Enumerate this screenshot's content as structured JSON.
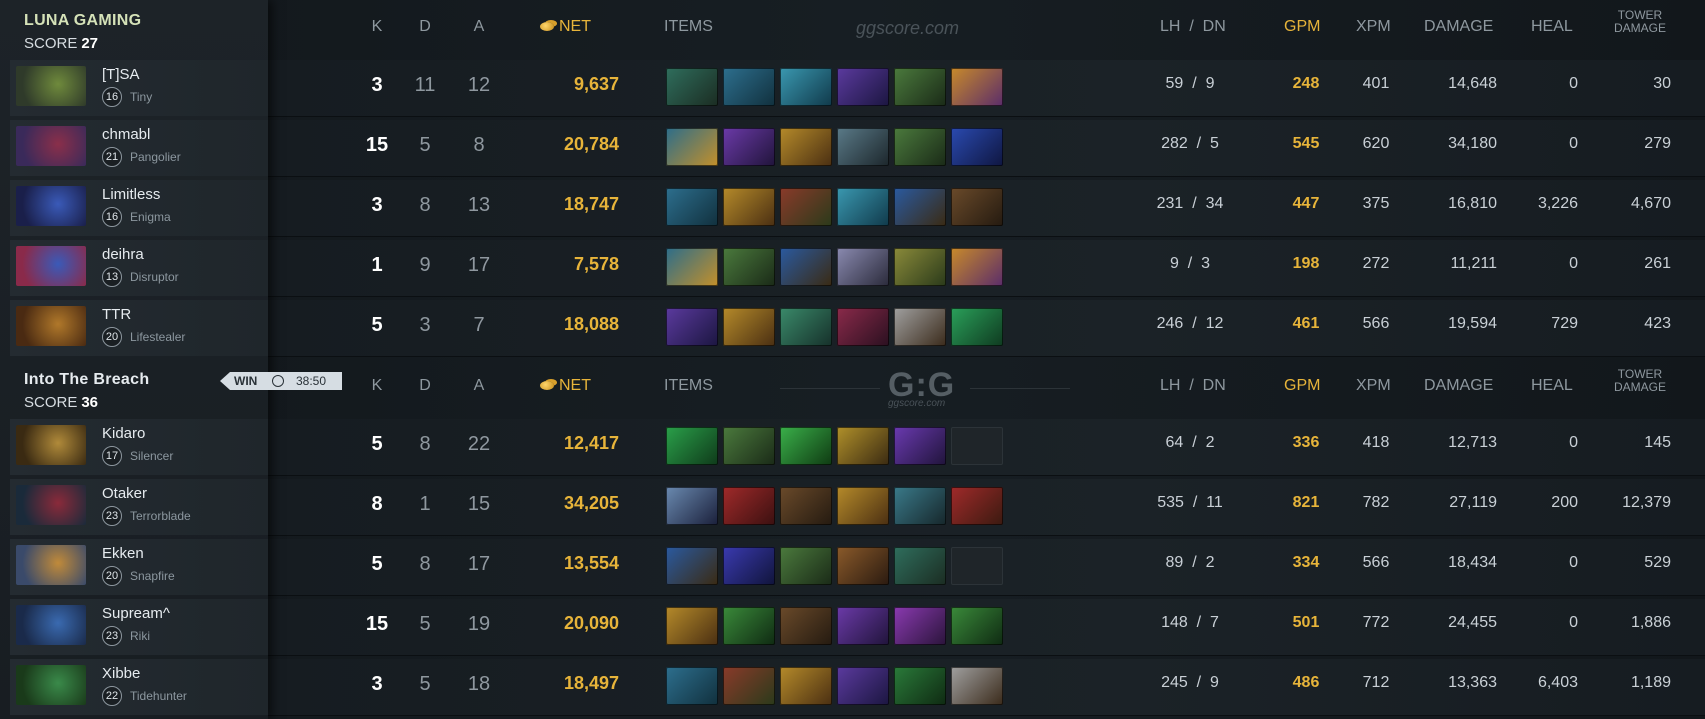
{
  "watermark_text": "ggscore.com",
  "logo": {
    "mark": "G:G",
    "sub": "ggscore.com"
  },
  "header_labels": {
    "k": "K",
    "d": "D",
    "a": "A",
    "net": "NET",
    "items": "ITEMS",
    "lh_dn": "LH  /  DN",
    "gpm": "GPM",
    "xpm": "XPM",
    "damage": "DAMAGE",
    "heal": "HEAL",
    "tower_line1": "TOWER",
    "tower_line2": "DAMAGE"
  },
  "result": {
    "label": "WIN",
    "time": "38:50"
  },
  "teams": [
    {
      "name": "LUNA GAMING",
      "name_color": "#d5e2b8",
      "score_label": "SCORE",
      "score": "27",
      "players": [
        {
          "name": "[T]SA",
          "level": "16",
          "hero": "Tiny",
          "hero_colors": [
            "#6f8a3c",
            "#2f3a2a"
          ],
          "k": "3",
          "d": "11",
          "a": "12",
          "net": "9,637",
          "lh": "59",
          "dn": "9",
          "gpm": "248",
          "xpm": "401",
          "damage": "14,648",
          "heal": "0",
          "tower": "30",
          "items": [
            [
              "#2f6e5d",
              "#1b2c22"
            ],
            [
              "#2d6f8e",
              "#11303d"
            ],
            [
              "#3a98b0",
              "#10394a"
            ],
            [
              "#5b3a9e",
              "#1b1640"
            ],
            [
              "#4b7a3d",
              "#1a2a17"
            ],
            [
              "#c88a2a",
              "#5a2c6a"
            ]
          ]
        },
        {
          "name": "chmabl",
          "level": "21",
          "hero": "Pangolier",
          "hero_colors": [
            "#8a2f4a",
            "#3a2a5a"
          ],
          "k": "15",
          "d": "5",
          "a": "8",
          "net": "20,784",
          "lh": "282",
          "dn": "5",
          "gpm": "545",
          "xpm": "620",
          "damage": "34,180",
          "heal": "0",
          "tower": "279",
          "items": [
            [
              "#2c6d8a",
              "#c4902a"
            ],
            [
              "#6b3aa8",
              "#20143a"
            ],
            [
              "#b58a2a",
              "#4a2f12"
            ],
            [
              "#5a7a88",
              "#1c262b"
            ],
            [
              "#4b7a3d",
              "#1a2a17"
            ],
            [
              "#2a4ab0",
              "#0f1640"
            ]
          ]
        },
        {
          "name": "Limitless",
          "level": "16",
          "hero": "Enigma",
          "hero_colors": [
            "#3a5ab8",
            "#1a1f4a"
          ],
          "k": "3",
          "d": "8",
          "a": "13",
          "net": "18,747",
          "lh": "231",
          "dn": "34",
          "gpm": "447",
          "xpm": "375",
          "damage": "16,810",
          "heal": "3,226",
          "tower": "4,670",
          "items": [
            [
              "#2d6f8e",
              "#11303d"
            ],
            [
              "#b58a2a",
              "#4a2f12"
            ],
            [
              "#8a3a2a",
              "#2a3a1a"
            ],
            [
              "#3a98b0",
              "#10394a"
            ],
            [
              "#2a5aa0",
              "#3a2a12"
            ],
            [
              "#6a4a2a",
              "#241a10"
            ]
          ]
        },
        {
          "name": "deihra",
          "level": "13",
          "hero": "Disruptor",
          "hero_colors": [
            "#3a5ab8",
            "#8a2a4a"
          ],
          "k": "1",
          "d": "9",
          "a": "17",
          "net": "7,578",
          "lh": "9",
          "dn": "3",
          "gpm": "198",
          "xpm": "272",
          "damage": "11,211",
          "heal": "0",
          "tower": "261",
          "items": [
            [
              "#2c6d8a",
              "#c4902a"
            ],
            [
              "#4b7a3d",
              "#1a2a17"
            ],
            [
              "#2a5aa0",
              "#3a2a12"
            ],
            [
              "#8a8ab0",
              "#2a2a3a"
            ],
            [
              "#8a8a3a",
              "#2a3a1a"
            ],
            [
              "#c88a2a",
              "#5a2c6a"
            ]
          ]
        },
        {
          "name": "TTR",
          "level": "20",
          "hero": "Lifestealer",
          "hero_colors": [
            "#b0782a",
            "#4a2a12"
          ],
          "k": "5",
          "d": "3",
          "a": "7",
          "net": "18,088",
          "lh": "246",
          "dn": "12",
          "gpm": "461",
          "xpm": "566",
          "damage": "19,594",
          "heal": "729",
          "tower": "423",
          "items": [
            [
              "#5b3a9e",
              "#1b1640"
            ],
            [
              "#b58a2a",
              "#4a2f12"
            ],
            [
              "#3a8a6a",
              "#16302a"
            ],
            [
              "#8a2a4a",
              "#2a1020"
            ],
            [
              "#a0a0a0",
              "#3a2a1a"
            ],
            [
              "#2aa05a",
              "#0f3a20"
            ]
          ]
        }
      ]
    },
    {
      "name": "Into The Breach",
      "name_color": "#e6ebef",
      "score_label": "SCORE",
      "score": "36",
      "players": [
        {
          "name": "Kidaro",
          "level": "17",
          "hero": "Silencer",
          "hero_colors": [
            "#b08a3a",
            "#3a2a12"
          ],
          "k": "5",
          "d": "8",
          "a": "22",
          "net": "12,417",
          "lh": "64",
          "dn": "2",
          "gpm": "336",
          "xpm": "418",
          "damage": "12,713",
          "heal": "0",
          "tower": "145",
          "items": [
            [
              "#2aa04a",
              "#0f3a1a"
            ],
            [
              "#4b7a3d",
              "#1a2a17"
            ],
            [
              "#3ab04a",
              "#0f3a12"
            ],
            [
              "#b0902a",
              "#3a2a12"
            ],
            [
              "#6a3ab0",
              "#20143a"
            ],
            [
              "#1f2529",
              "#1f2529"
            ]
          ]
        },
        {
          "name": "Otaker",
          "level": "23",
          "hero": "Terrorblade",
          "hero_colors": [
            "#8a2a3a",
            "#1a2a3a"
          ],
          "k": "8",
          "d": "1",
          "a": "15",
          "net": "34,205",
          "lh": "535",
          "dn": "11",
          "gpm": "821",
          "xpm": "782",
          "damage": "27,119",
          "heal": "200",
          "tower": "12,379",
          "items": [
            [
              "#6a8ab0",
              "#1a1f3a"
            ],
            [
              "#a02a2a",
              "#3a1010"
            ],
            [
              "#6a4a2a",
              "#241a10"
            ],
            [
              "#b58a2a",
              "#4a2f12"
            ],
            [
              "#3a7a8a",
              "#16262a"
            ],
            [
              "#a02a2a",
              "#3a1a10"
            ]
          ]
        },
        {
          "name": "Ekken",
          "level": "20",
          "hero": "Snapfire",
          "hero_colors": [
            "#c08a3a",
            "#3a4a6a"
          ],
          "k": "5",
          "d": "8",
          "a": "17",
          "net": "13,554",
          "lh": "89",
          "dn": "2",
          "gpm": "334",
          "xpm": "566",
          "damage": "18,434",
          "heal": "0",
          "tower": "529",
          "items": [
            [
              "#2a5aa0",
              "#3a2a12"
            ],
            [
              "#3a3ab0",
              "#10143a"
            ],
            [
              "#4b7a3d",
              "#1a2a17"
            ],
            [
              "#8a5a2a",
              "#2a1a10"
            ],
            [
              "#2f6e5d",
              "#1b2c22"
            ],
            [
              "#1f2529",
              "#1f2529"
            ]
          ]
        },
        {
          "name": "Supream^",
          "level": "23",
          "hero": "Riki",
          "hero_colors": [
            "#3a6ab0",
            "#1a2a4a"
          ],
          "k": "15",
          "d": "5",
          "a": "19",
          "net": "20,090",
          "lh": "148",
          "dn": "7",
          "gpm": "501",
          "xpm": "772",
          "damage": "24,455",
          "heal": "0",
          "tower": "1,886",
          "items": [
            [
              "#b58a2a",
              "#4a2f12"
            ],
            [
              "#3a8a3a",
              "#0f2a12"
            ],
            [
              "#6a4a2a",
              "#241a10"
            ],
            [
              "#6b3aa8",
              "#20143a"
            ],
            [
              "#8a3ab0",
              "#2a143a"
            ],
            [
              "#3a8a3a",
              "#0f2a12"
            ]
          ]
        },
        {
          "name": "Xibbe",
          "level": "22",
          "hero": "Tidehunter",
          "hero_colors": [
            "#3a8a4a",
            "#1a3a1a"
          ],
          "k": "3",
          "d": "5",
          "a": "18",
          "net": "18,497",
          "lh": "245",
          "dn": "9",
          "gpm": "486",
          "xpm": "712",
          "damage": "13,363",
          "heal": "6,403",
          "tower": "1,189",
          "items": [
            [
              "#2d6f8e",
              "#11303d"
            ],
            [
              "#8a3a2a",
              "#2a3a1a"
            ],
            [
              "#b58a2a",
              "#4a2f12"
            ],
            [
              "#5b3a9e",
              "#1b1640"
            ],
            [
              "#2a7a3a",
              "#0f2a12"
            ],
            [
              "#a0a0a0",
              "#3a2a1a"
            ]
          ]
        }
      ]
    }
  ]
}
